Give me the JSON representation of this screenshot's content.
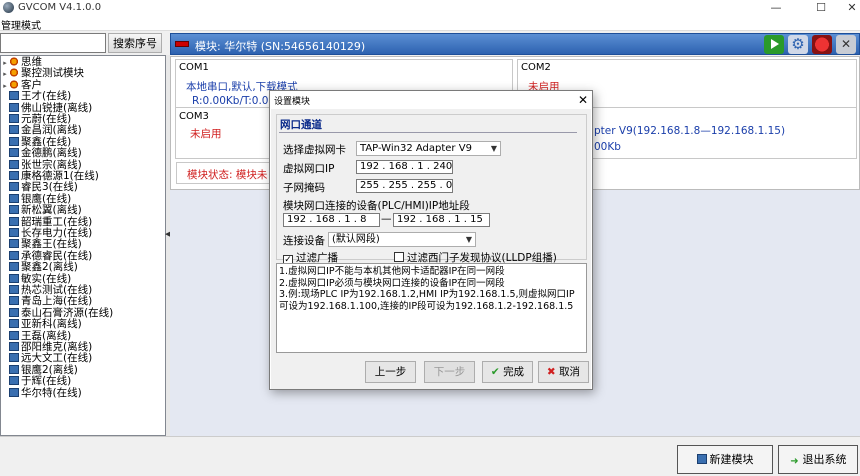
{
  "window": {
    "title": "GVCOM V4.1.0.0",
    "minimize": "—",
    "maximize": "☐",
    "close": "✕"
  },
  "menu": {
    "manage": "管理模式"
  },
  "search": {
    "placeholder": "",
    "button": "搜索序号"
  },
  "tree": {
    "groups": [
      "思维",
      "聚控测试模块",
      "客户"
    ],
    "devices": [
      "王才(在线)",
      "佛山锐捷(离线)",
      "元蔚(在线)",
      "金昌润(离线)",
      "聚鑫(在线)",
      "金德鹏(离线)",
      "张世宗(离线)",
      "康格德源1(在线)",
      "睿民3(在线)",
      "银鹰(在线)",
      "新松翼(离线)",
      "韶瑞重工(在线)",
      "长存电力(在线)",
      "聚鑫王(在线)",
      "承德睿民(在线)",
      "聚鑫2(离线)",
      "敏实(在线)",
      "热芯测试(在线)",
      "青岛上海(在线)",
      "泰山石膏济源(在线)",
      "亚新科(离线)",
      "王磊(离线)",
      "邵阳维克(离线)",
      "远大文工(在线)",
      "银鹰2(离线)",
      "于辉(在线)",
      "华尔特(在线)"
    ]
  },
  "module_header": {
    "label": "模块: 华尔特 (SN:54656140129)"
  },
  "com1": {
    "title": "COM1",
    "line1": "本地串口,默认,下载模式",
    "line2": "R:0.00Kb/T:0.00Kb"
  },
  "com2": {
    "title": "COM2",
    "status": "未启用"
  },
  "com3": {
    "title": "COM3",
    "status": "未启用"
  },
  "com_right": {
    "line1": "pter V9(192.168.1.8—192.168.1.15)",
    "line2": "00Kb"
  },
  "module_status": {
    "text": "模块状态: 模块未"
  },
  "footer": {
    "new_module": "新建模块",
    "exit": "退出系统"
  },
  "dialog": {
    "title": "设置模块",
    "close": "✕",
    "group_title": "网口通道",
    "nic_label": "选择虚拟网卡",
    "nic_value": "TAP-Win32 Adapter V9",
    "vip_label": "虚拟网口IP",
    "vip_value": "192 . 168 .  1  . 240",
    "mask_label": "子网掩码",
    "mask_value": "255 . 255 . 255 .  0",
    "range_label": "模块网口连接的设备(PLC/HMI)IP地址段",
    "range_start": "192 . 168 .  1  .  8",
    "range_dash": "—",
    "range_end": "192 . 168 .  1  . 15",
    "conn_label": "连接设备",
    "conn_value": "(默认网段)",
    "filter_broadcast": "过滤广播",
    "filter_lldp": "过滤西门子发现协议(LLDP组播)",
    "notes": "1.虚拟网口IP不能与本机其他网卡适配器IP在同一网段\n2.虚拟网口IP必须与模块网口连接的设备IP在同一网段\n3.例:现场PLC IP为192.168.1.2,HMI IP为192.168.1.5,则虚拟网口IP可设为192.168.1.100,连接的IP段可设为192.168.1.2-192.168.1.5",
    "prev": "上一步",
    "next": "下一步",
    "finish": "完成",
    "cancel": "取消"
  },
  "colors": {
    "header_blue": "#2d62b0",
    "status_red": "#d02020",
    "text_blue": "#1a3eaa"
  }
}
